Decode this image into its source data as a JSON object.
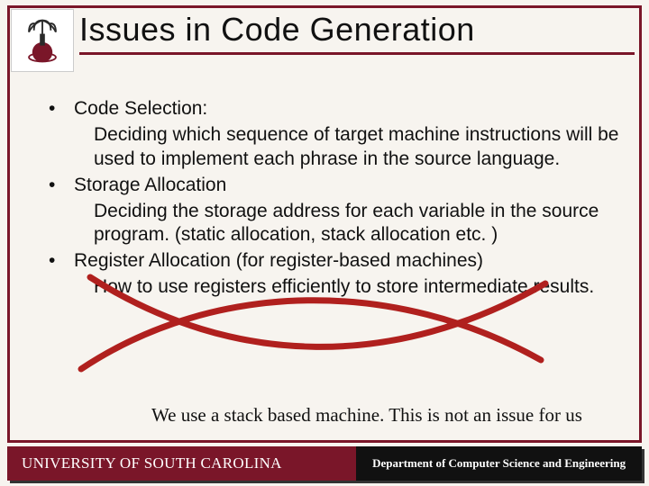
{
  "title": "Issues in Code Generation",
  "bullets": [
    {
      "head": "Code Selection:",
      "body": "Deciding which sequence of target machine instructions will be used to implement each phrase in the source language."
    },
    {
      "head": "Storage Allocation",
      "body": "Deciding the storage address for each variable in the source program. (static allocation, stack allocation etc. )"
    },
    {
      "head": "Register Allocation (for register-based machines)",
      "body": "How to use registers efficiently to store intermediate results."
    }
  ],
  "note": "We use a stack based machine. This is not an issue for us",
  "footer": {
    "left": "UNIVERSITY OF SOUTH CAROLINA",
    "right": "Department of Computer Science and Engineering"
  },
  "logo_alt": "University of South Carolina seal"
}
